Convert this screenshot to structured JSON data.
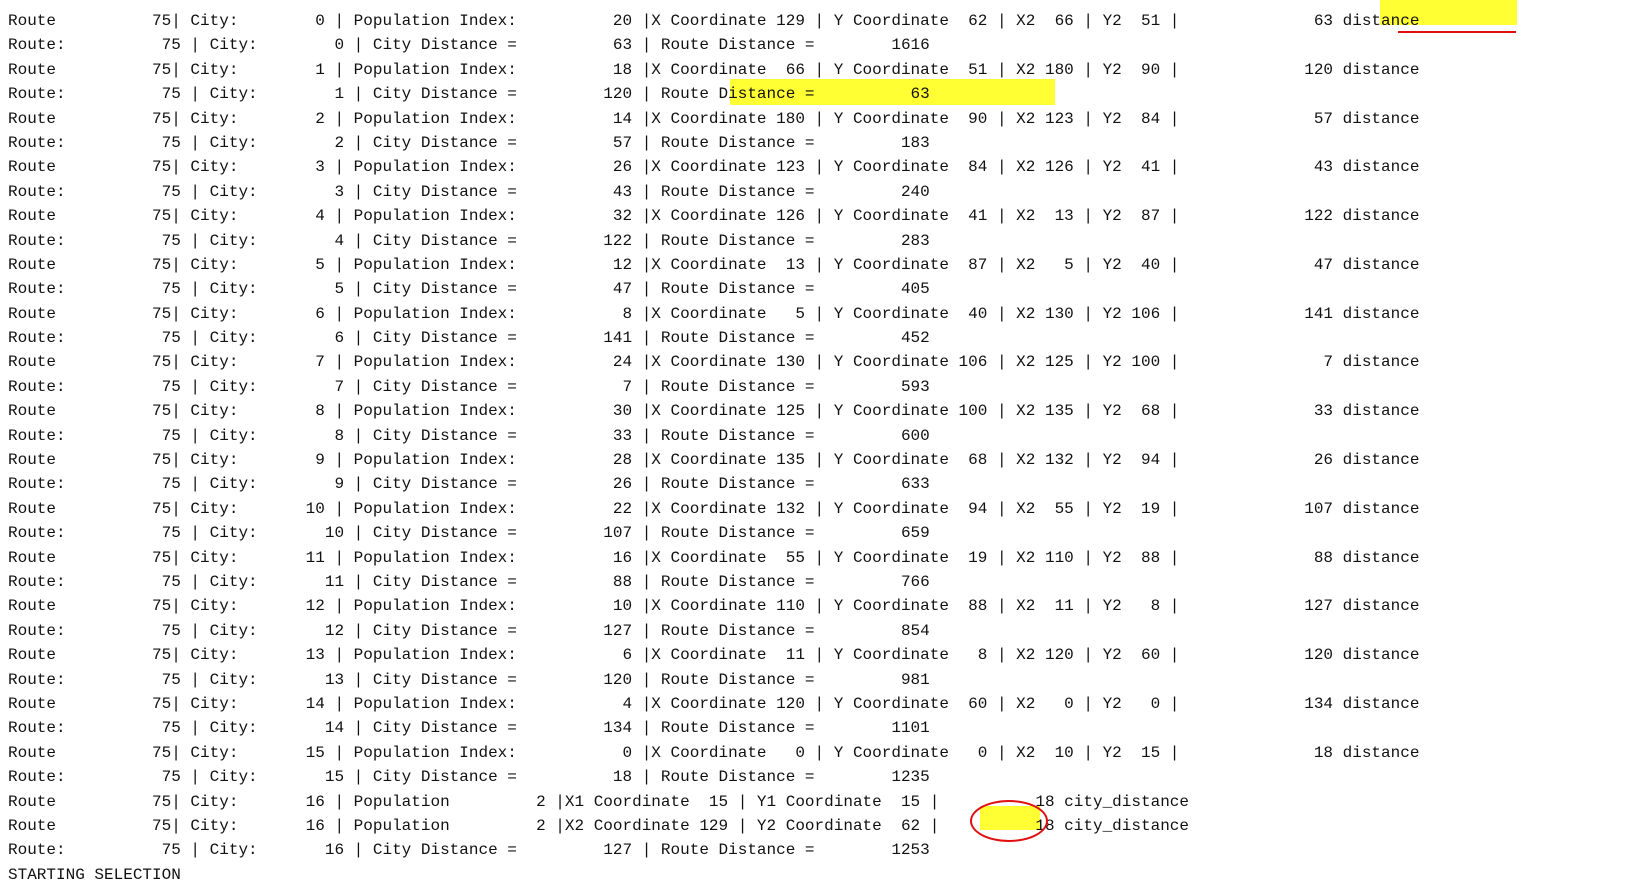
{
  "console": {
    "lines": [
      "Route          75| City:        0 | Population Index:          20 |X Coordinate 129 | Y Coordinate  62 | X2  66 | Y2  51 |              63 distance",
      "Route:          75 | City:        0 | City Distance =          63 | Route Distance =        1616",
      "Route          75| City:        1 | Population Index:          18 |X Coordinate  66 | Y Coordinate  51 | X2 180 | Y2  90 |             120 distance",
      "Route:          75 | City:        1 | City Distance =         120 | Route Distance =          63",
      "Route          75| City:        2 | Population Index:          14 |X Coordinate 180 | Y Coordinate  90 | X2 123 | Y2  84 |              57 distance",
      "Route:          75 | City:        2 | City Distance =          57 | Route Distance =         183",
      "Route          75| City:        3 | Population Index:          26 |X Coordinate 123 | Y Coordinate  84 | X2 126 | Y2  41 |              43 distance",
      "Route:          75 | City:        3 | City Distance =          43 | Route Distance =         240",
      "Route          75| City:        4 | Population Index:          32 |X Coordinate 126 | Y Coordinate  41 | X2  13 | Y2  87 |             122 distance",
      "Route:          75 | City:        4 | City Distance =         122 | Route Distance =         283",
      "Route          75| City:        5 | Population Index:          12 |X Coordinate  13 | Y Coordinate  87 | X2   5 | Y2  40 |              47 distance",
      "Route:          75 | City:        5 | City Distance =          47 | Route Distance =         405",
      "Route          75| City:        6 | Population Index:           8 |X Coordinate   5 | Y Coordinate  40 | X2 130 | Y2 106 |             141 distance",
      "Route:          75 | City:        6 | City Distance =         141 | Route Distance =         452",
      "Route          75| City:        7 | Population Index:          24 |X Coordinate 130 | Y Coordinate 106 | X2 125 | Y2 100 |               7 distance",
      "Route:          75 | City:        7 | City Distance =           7 | Route Distance =         593",
      "Route          75| City:        8 | Population Index:          30 |X Coordinate 125 | Y Coordinate 100 | X2 135 | Y2  68 |              33 distance",
      "Route:          75 | City:        8 | City Distance =          33 | Route Distance =         600",
      "Route          75| City:        9 | Population Index:          28 |X Coordinate 135 | Y Coordinate  68 | X2 132 | Y2  94 |              26 distance",
      "Route:          75 | City:        9 | City Distance =          26 | Route Distance =         633",
      "Route          75| City:       10 | Population Index:          22 |X Coordinate 132 | Y Coordinate  94 | X2  55 | Y2  19 |             107 distance",
      "Route:          75 | City:       10 | City Distance =         107 | Route Distance =         659",
      "Route          75| City:       11 | Population Index:          16 |X Coordinate  55 | Y Coordinate  19 | X2 110 | Y2  88 |              88 distance",
      "Route:          75 | City:       11 | City Distance =          88 | Route Distance =         766",
      "Route          75| City:       12 | Population Index:          10 |X Coordinate 110 | Y Coordinate  88 | X2  11 | Y2   8 |             127 distance",
      "Route:          75 | City:       12 | City Distance =         127 | Route Distance =         854",
      "Route          75| City:       13 | Population Index:           6 |X Coordinate  11 | Y Coordinate   8 | X2 120 | Y2  60 |             120 distance",
      "Route:          75 | City:       13 | City Distance =         120 | Route Distance =         981",
      "Route          75| City:       14 | Population Index:           4 |X Coordinate 120 | Y Coordinate  60 | X2   0 | Y2   0 |             134 distance",
      "Route:          75 | City:       14 | City Distance =         134 | Route Distance =        1101",
      "Route          75| City:       15 | Population Index:           0 |X Coordinate   0 | Y Coordinate   0 | X2  10 | Y2  15 |              18 distance",
      "Route:          75 | City:       15 | City Distance =          18 | Route Distance =        1235",
      "Route          75| City:       16 | Population         2 |X1 Coordinate  15 | Y1 Coordinate  15 |          18 city_distance",
      "Route          75| City:       16 | Population         2 |X2 Coordinate 129 | Y2 Coordinate  62 |          18 city_distance",
      "Route:          75 | City:       16 | City Distance =         127 | Route Distance =        1253",
      "STARTING SELECTION"
    ]
  },
  "annotations": {
    "highlight_color": "#ffff33",
    "mark_color": "#e01010"
  }
}
